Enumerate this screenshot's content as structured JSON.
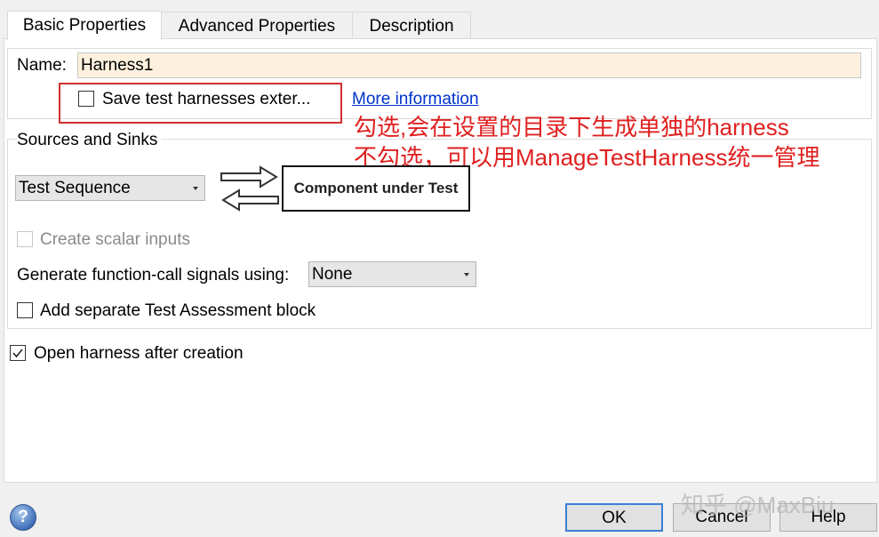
{
  "tabs": [
    {
      "label": "Basic Properties"
    },
    {
      "label": "Advanced Properties"
    },
    {
      "label": "Description"
    }
  ],
  "name_field": {
    "label": "Name:",
    "value": "Harness1"
  },
  "save_external": {
    "label": "Save test harnesses exter...",
    "checked": false
  },
  "more_info_link": "More information",
  "annotation": {
    "line1": "勾选,会在设置的目录下生成单独的harness",
    "line2": "不勾选，可以用ManageTestHarness统一管理"
  },
  "sources_sinks": {
    "title": "Sources and Sinks",
    "source_select": "Test Sequence",
    "component_box": "Component under Test",
    "create_scalar": {
      "label": "Create scalar inputs",
      "checked": false,
      "enabled": false
    },
    "function_call": {
      "label": "Generate function-call signals using:",
      "value": "None"
    },
    "assessment": {
      "label": "Add separate Test Assessment block",
      "checked": false
    }
  },
  "open_after": {
    "label": "Open harness after creation",
    "checked": true
  },
  "buttons": {
    "ok": "OK",
    "cancel": "Cancel",
    "help": "Help"
  },
  "watermark": "知乎 @MaxBiu",
  "colors": {
    "annotation": "#e02020",
    "highlight_box": "#d03030",
    "link": "#0033cc",
    "name_bg": "#fdf1dd"
  }
}
